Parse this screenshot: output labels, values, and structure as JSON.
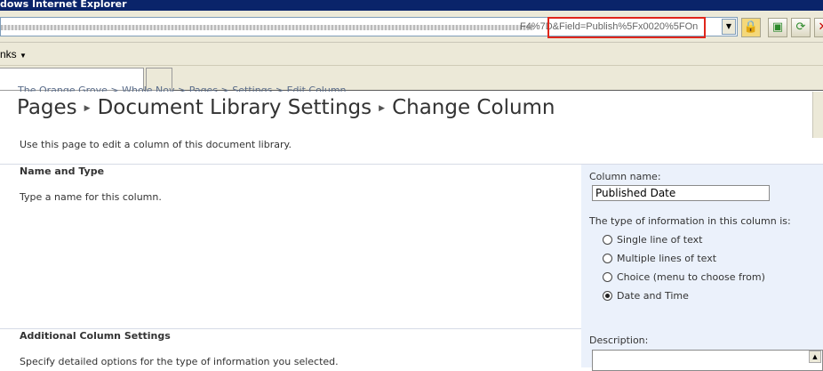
{
  "browser": {
    "title": "dows Internet Explorer",
    "address_tail": "F4%7D&Field=Publish%5Fx0020%5FOn",
    "links_label": "nks",
    "breadcrumb": "The Orange Grove  >  Whole Nov  >  Pages  >  Settings  >  Edit Column"
  },
  "page": {
    "title_parts": [
      "Pages",
      "Document Library Settings",
      "Change Column"
    ],
    "description": "Use this page to edit a column of this document library."
  },
  "sections": {
    "name_type": {
      "title": "Name and Type",
      "desc": "Type a name for this column."
    },
    "additional": {
      "title": "Additional Column Settings",
      "desc": "Specify detailed options for the type of information you selected."
    }
  },
  "form": {
    "column_name_label": "Column name:",
    "column_name_value": "Published Date",
    "type_label": "The type of information in this column is:",
    "types": [
      {
        "label": "Single line of text",
        "checked": false
      },
      {
        "label": "Multiple lines of text",
        "checked": false
      },
      {
        "label": "Choice (menu to choose from)",
        "checked": false
      },
      {
        "label": "Date and Time",
        "checked": true
      }
    ],
    "description_label": "Description:"
  },
  "colors": {
    "titlebar": "#0a246a",
    "highlight": "#e0261b",
    "panel": "#ebf1fb"
  }
}
